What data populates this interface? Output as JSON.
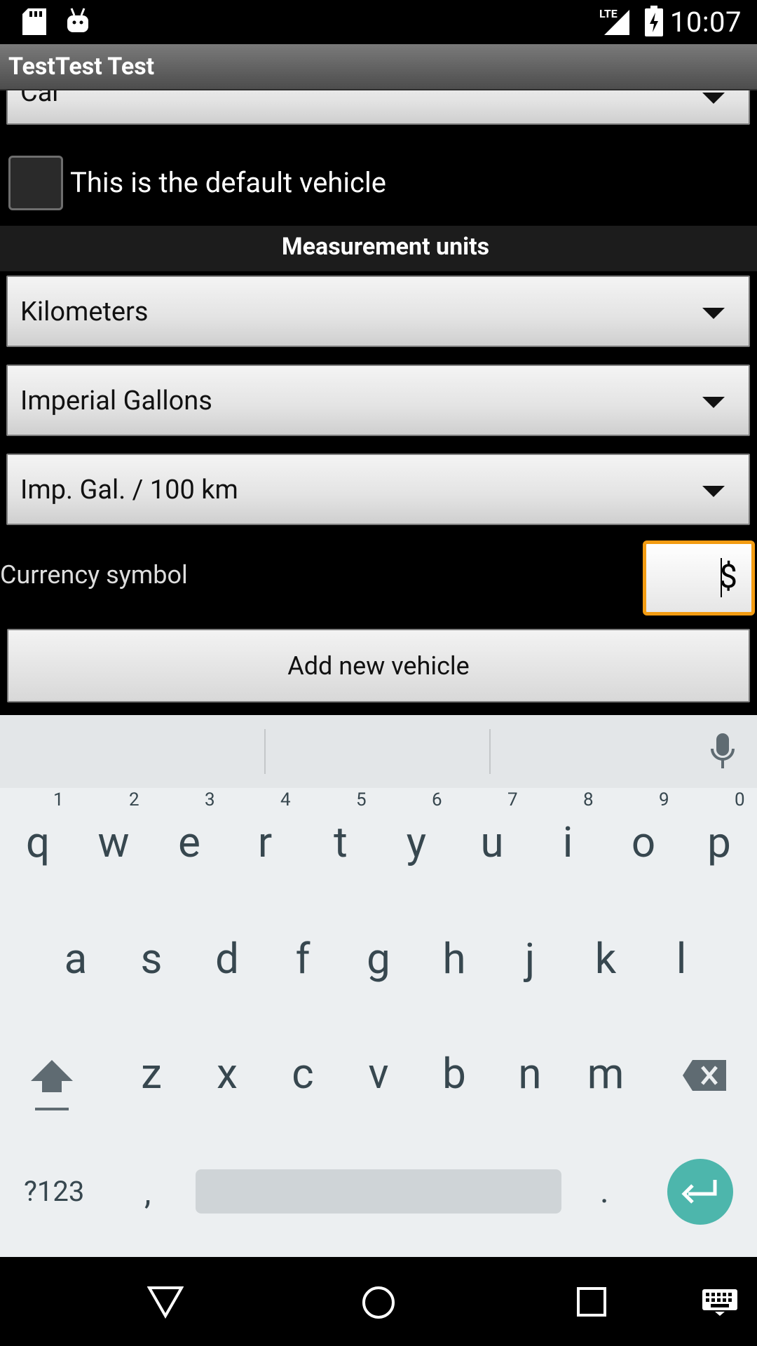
{
  "status_bar": {
    "time": "10:07",
    "network": "LTE"
  },
  "action_bar": {
    "title": "TestTest Test"
  },
  "form": {
    "top_spinner_value": "Car",
    "default_checkbox_label": "This is the default vehicle",
    "default_checked": false,
    "section_title": "Measurement units",
    "distance_unit": "Kilometers",
    "volume_unit": "Imperial Gallons",
    "consumption_unit": "Imp. Gal. / 100 km",
    "currency_label": "Currency symbol",
    "currency_value": "$",
    "add_button_label": "Add new vehicle"
  },
  "keyboard": {
    "row1": [
      "q",
      "w",
      "e",
      "r",
      "t",
      "y",
      "u",
      "i",
      "o",
      "p"
    ],
    "row1_hints": [
      "1",
      "2",
      "3",
      "4",
      "5",
      "6",
      "7",
      "8",
      "9",
      "0"
    ],
    "row2": [
      "a",
      "s",
      "d",
      "f",
      "g",
      "h",
      "j",
      "k",
      "l"
    ],
    "row3": [
      "z",
      "x",
      "c",
      "v",
      "b",
      "n",
      "m"
    ],
    "symbols_key": "?123",
    "comma_key": ",",
    "period_key": "."
  },
  "colors": {
    "accent_focus": "#f39c12",
    "enter_key": "#4db6ac",
    "keyboard_bg": "#eceff1"
  }
}
